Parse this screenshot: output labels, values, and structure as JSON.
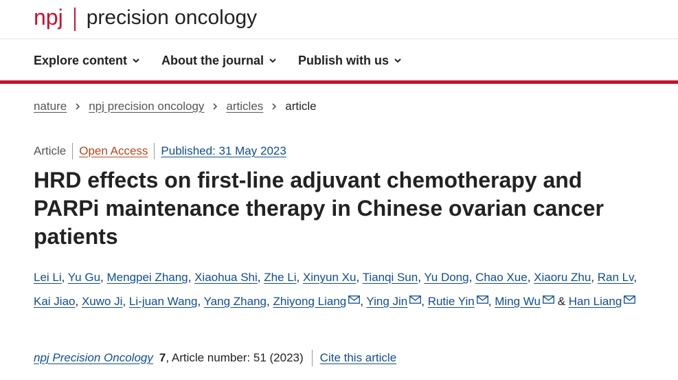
{
  "header": {
    "logo_text": "npj",
    "journal_name": "precision oncology"
  },
  "nav": {
    "items": [
      {
        "label": "Explore content"
      },
      {
        "label": "About the journal"
      },
      {
        "label": "Publish with us"
      }
    ]
  },
  "breadcrumb": {
    "items": [
      "nature",
      "npj precision oncology",
      "articles"
    ],
    "current": "article"
  },
  "meta": {
    "article_type": "Article",
    "access": "Open Access",
    "published": "Published: 31 May 2023"
  },
  "title": "HRD effects on first-line adjuvant chemotherapy and PARPi maintenance therapy in Chinese ovarian cancer patients",
  "authors": [
    {
      "name": "Lei Li",
      "sep": ", "
    },
    {
      "name": "Yu Gu",
      "sep": ", "
    },
    {
      "name": "Mengpei Zhang",
      "sep": ", "
    },
    {
      "name": "Xiaohua Shi",
      "sep": ", "
    },
    {
      "name": "Zhe Li",
      "sep": ", "
    },
    {
      "name": "Xinyun Xu",
      "sep": ", "
    },
    {
      "name": "Tianqi Sun",
      "sep": ", "
    },
    {
      "name": "Yu Dong",
      "sep": ", "
    },
    {
      "name": "Chao Xue",
      "sep": ", "
    },
    {
      "name": "Xiaoru Zhu",
      "sep": ", "
    },
    {
      "name": "Ran Lv",
      "sep": ", "
    },
    {
      "name": "Kai Jiao",
      "sep": ", "
    },
    {
      "name": "Xuwo Ji",
      "sep": ", "
    },
    {
      "name": "Li-juan Wang",
      "sep": ", "
    },
    {
      "name": "Yang Zhang",
      "sep": ", "
    },
    {
      "name": "Zhiyong Liang",
      "sep": ", "
    },
    {
      "name": "Ying Jin",
      "sep": ", "
    },
    {
      "name": "Rutie Yin",
      "sep": ", "
    },
    {
      "name": "Ming Wu",
      "sep": " & "
    },
    {
      "name": "Han Liang",
      "sep": ""
    }
  ],
  "citation": {
    "journal": "npj Precision Oncology",
    "volume": "7",
    "article_info": ", Article number: 51 (2023)",
    "cite_label": "Cite this article"
  },
  "colors": {
    "brand_red": "#c8102e",
    "link_blue": "#0f4d92",
    "open_access_orange": "#b5461a"
  }
}
